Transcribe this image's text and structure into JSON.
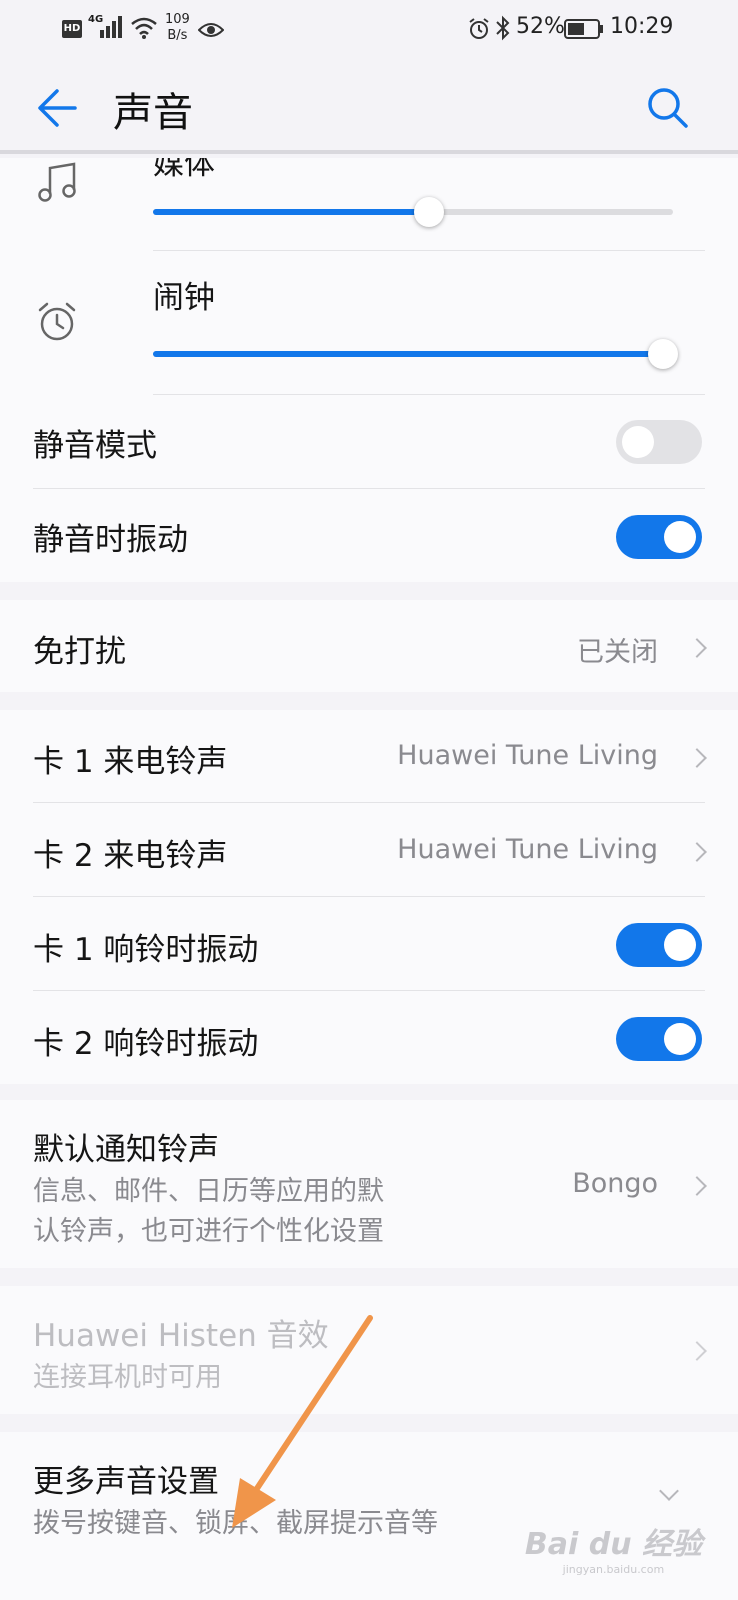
{
  "status_bar": {
    "hd": "HD",
    "network": "4G",
    "speed": "109",
    "speed_unit": "B/s",
    "battery": "52%",
    "time": "10:29"
  },
  "app_bar": {
    "title": "声音"
  },
  "volume": {
    "media_label": "媒体",
    "media_level": 0.53,
    "alarm_label": "闹钟",
    "alarm_level": 1.0
  },
  "toggles_section": {
    "silent_label": "静音模式",
    "silent_on": false,
    "vibrate_silent_label": "静音时振动",
    "vibrate_silent_on": true
  },
  "dnd": {
    "label": "免打扰",
    "value": "已关闭"
  },
  "ringtones": {
    "sim1_label": "卡 1 来电铃声",
    "sim1_value": "Huawei Tune Living",
    "sim2_label": "卡 2 来电铃声",
    "sim2_value": "Huawei Tune Living",
    "sim1_vibrate_label": "卡 1 响铃时振动",
    "sim1_vibrate_on": true,
    "sim2_vibrate_label": "卡 2 响铃时振动",
    "sim2_vibrate_on": true
  },
  "notification": {
    "label": "默认通知铃声",
    "desc_line1": "信息、邮件、日历等应用的默",
    "desc_line2": "认铃声，也可进行个性化设置",
    "value": "Bongo"
  },
  "histen": {
    "label": "Huawei Histen 音效",
    "desc": "连接耳机时可用"
  },
  "more": {
    "label": "更多声音设置",
    "desc": "拨号按键音、锁屏、截屏提示音等"
  },
  "watermark": {
    "brand": "Bai du 经验",
    "url": "jingyan.baidu.com"
  },
  "colors": {
    "accent": "#1277ea",
    "annotation_arrow": "#f0954a"
  }
}
